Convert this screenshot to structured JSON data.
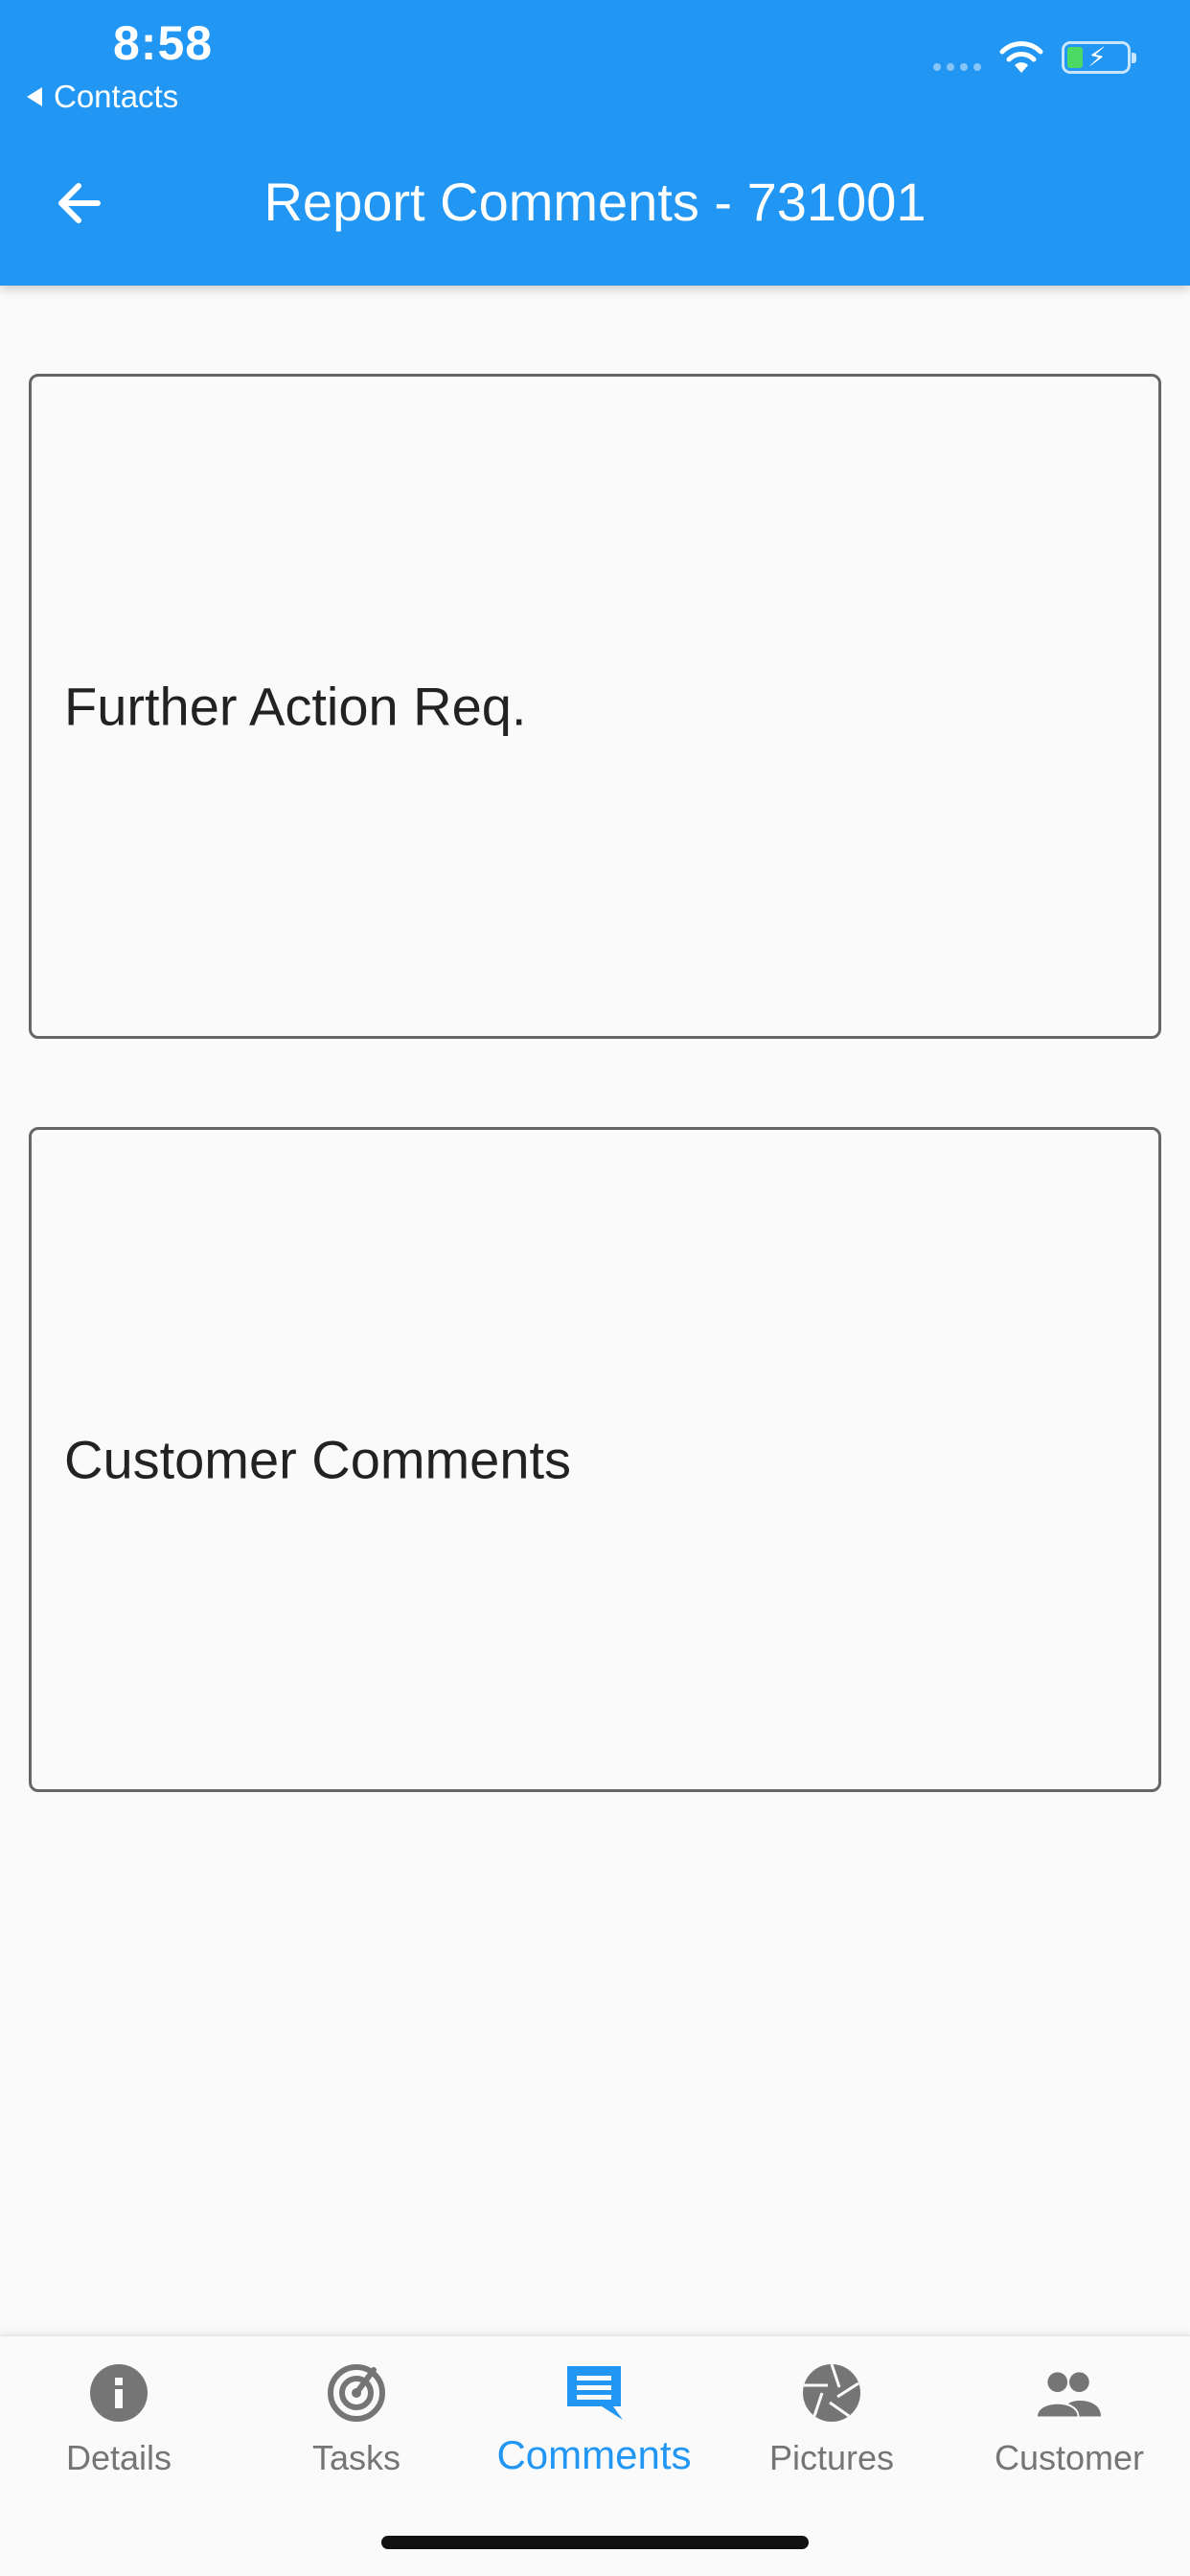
{
  "status_bar": {
    "time": "8:58",
    "back_app_label": "Contacts",
    "battery_color": "#4cd964"
  },
  "app_bar": {
    "title": "Report Comments - 731001",
    "color": "#2196f3",
    "back_icon": "arrow-left-icon"
  },
  "fields": [
    {
      "label": "Further Action Req.",
      "value": ""
    },
    {
      "label": "Customer Comments",
      "value": ""
    }
  ],
  "bottom_nav": {
    "active_color": "#2196f3",
    "items": [
      {
        "label": "Details",
        "icon": "info-icon",
        "active": false
      },
      {
        "label": "Tasks",
        "icon": "target-icon",
        "active": false
      },
      {
        "label": "Comments",
        "icon": "comment-icon",
        "active": true
      },
      {
        "label": "Pictures",
        "icon": "camera-aperture-icon",
        "active": false
      },
      {
        "label": "Customer",
        "icon": "people-icon",
        "active": false
      }
    ]
  }
}
